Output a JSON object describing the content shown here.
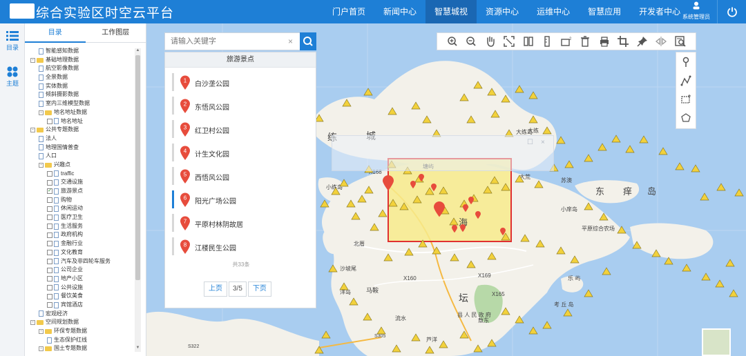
{
  "header": {
    "title": "综合实验区时空云平台",
    "nav": [
      "门户首页",
      "新闻中心",
      "智慧城视",
      "资源中心",
      "运维中心",
      "智慧应用",
      "开发者中心"
    ],
    "active_nav": "智慧城视",
    "user_label": "系统管理员",
    "brand_color": "#1e7fd6"
  },
  "rail": {
    "catalog_label": "目录",
    "theme_label": "主题"
  },
  "tree_panel": {
    "tabs": [
      "目录",
      "工作图层"
    ],
    "items": [
      {
        "label": "智能感知数据",
        "level": 1,
        "type": "doc"
      },
      {
        "label": "基础地理数据",
        "level": 0,
        "type": "folder",
        "toggle": "-"
      },
      {
        "label": "航空影像数据",
        "level": 1,
        "type": "doc"
      },
      {
        "label": "全景数据",
        "level": 1,
        "type": "doc"
      },
      {
        "label": "实体数据",
        "level": 1,
        "type": "doc"
      },
      {
        "label": "倾斜摄影数据",
        "level": 1,
        "type": "doc"
      },
      {
        "label": "室内三维模型数据",
        "level": 1,
        "type": "doc"
      },
      {
        "label": "地名地址数据",
        "level": 1,
        "type": "folder",
        "toggle": "-"
      },
      {
        "label": "地名地址",
        "level": 2,
        "type": "doc",
        "check": false
      },
      {
        "label": "公共专题数据",
        "level": 0,
        "type": "folder",
        "toggle": "-"
      },
      {
        "label": "法人",
        "level": 1,
        "type": "doc"
      },
      {
        "label": "地理国情普查",
        "level": 1,
        "type": "doc"
      },
      {
        "label": "人口",
        "level": 1,
        "type": "doc"
      },
      {
        "label": "兴趣点",
        "level": 1,
        "type": "folder",
        "toggle": "-"
      },
      {
        "label": "traffic",
        "level": 2,
        "type": "doc",
        "check": false
      },
      {
        "label": "交通设施",
        "level": 2,
        "type": "doc",
        "check": false
      },
      {
        "label": "旅游景点",
        "level": 2,
        "type": "doc",
        "check": true
      },
      {
        "label": "购物",
        "level": 2,
        "type": "doc",
        "check": false
      },
      {
        "label": "休闲运动",
        "level": 2,
        "type": "doc",
        "check": false
      },
      {
        "label": "医疗卫生",
        "level": 2,
        "type": "doc",
        "check": false
      },
      {
        "label": "生活服务",
        "level": 2,
        "type": "doc",
        "check": false
      },
      {
        "label": "政府机构",
        "level": 2,
        "type": "doc",
        "check": false
      },
      {
        "label": "金融行业",
        "level": 2,
        "type": "doc",
        "check": false
      },
      {
        "label": "文化教育",
        "level": 2,
        "type": "doc",
        "check": false
      },
      {
        "label": "汽车及非四轮车服务",
        "level": 2,
        "type": "doc",
        "check": false
      },
      {
        "label": "公司企业",
        "level": 2,
        "type": "doc",
        "check": false
      },
      {
        "label": "地产小区",
        "level": 2,
        "type": "doc",
        "check": false
      },
      {
        "label": "公共设施",
        "level": 2,
        "type": "doc",
        "check": false
      },
      {
        "label": "餐饮美食",
        "level": 2,
        "type": "doc",
        "check": false
      },
      {
        "label": "宾馆酒店",
        "level": 2,
        "type": "doc",
        "check": false
      },
      {
        "label": "宏观经济",
        "level": 1,
        "type": "doc"
      },
      {
        "label": "空间规划数据",
        "level": 0,
        "type": "folder",
        "toggle": "-"
      },
      {
        "label": "环保专题数据",
        "level": 1,
        "type": "folder",
        "toggle": "-"
      },
      {
        "label": "生态保护红线",
        "level": 2,
        "type": "doc"
      },
      {
        "label": "国土专题数据",
        "level": 1,
        "type": "folder",
        "toggle": "-"
      }
    ]
  },
  "search": {
    "placeholder": "请输入关键字",
    "clear": "×"
  },
  "results": {
    "header": "旅游景点",
    "items": [
      {
        "num": "1",
        "name": "白沙垄公园"
      },
      {
        "num": "2",
        "name": "东悟风公园"
      },
      {
        "num": "3",
        "name": "红卫村公园"
      },
      {
        "num": "4",
        "name": "计生文化园"
      },
      {
        "num": "5",
        "name": "西悟风公园"
      },
      {
        "num": "6",
        "name": "阳光广场公园"
      },
      {
        "num": "7",
        "name": "平原村林阴故居"
      },
      {
        "num": "8",
        "name": "江楼民生公园"
      }
    ],
    "hovered_index": 5,
    "total": "共33条",
    "prev": "上页",
    "page": "3/5",
    "next": "下页",
    "marker_color": "#e74c3c"
  },
  "map": {
    "water_color": "#a9cdf0",
    "land_color": "#f3f1ea",
    "highlight_fill": "#f7eb8c",
    "highlight_stroke": "#e03030",
    "labels": [
      "练",
      "城",
      "海",
      "坛",
      "东",
      "痒",
      "岛",
      "小练岛",
      "大练岛",
      "大练",
      "马鞍",
      "考 丘 岛",
      "乐 屿",
      "小庠岛",
      "芦洋",
      "平原综合农场",
      "北厝",
      "X160",
      "X168",
      "X169",
      "X165",
      "S322",
      "S305",
      "沙坡尾",
      "大荒",
      "苏澳",
      "敖东",
      "洋岛",
      "塘屿",
      "流水",
      "县 人 民 政 府"
    ],
    "toolbar_tools": [
      "zoom-in",
      "zoom-out",
      "pan",
      "full-extent",
      "swipe",
      "measure-length",
      "measure-area",
      "clear",
      "print",
      "crop",
      "pin",
      "compare",
      "query"
    ],
    "vertical_tools": [
      "point",
      "polyline",
      "rectangle",
      "polygon"
    ]
  }
}
